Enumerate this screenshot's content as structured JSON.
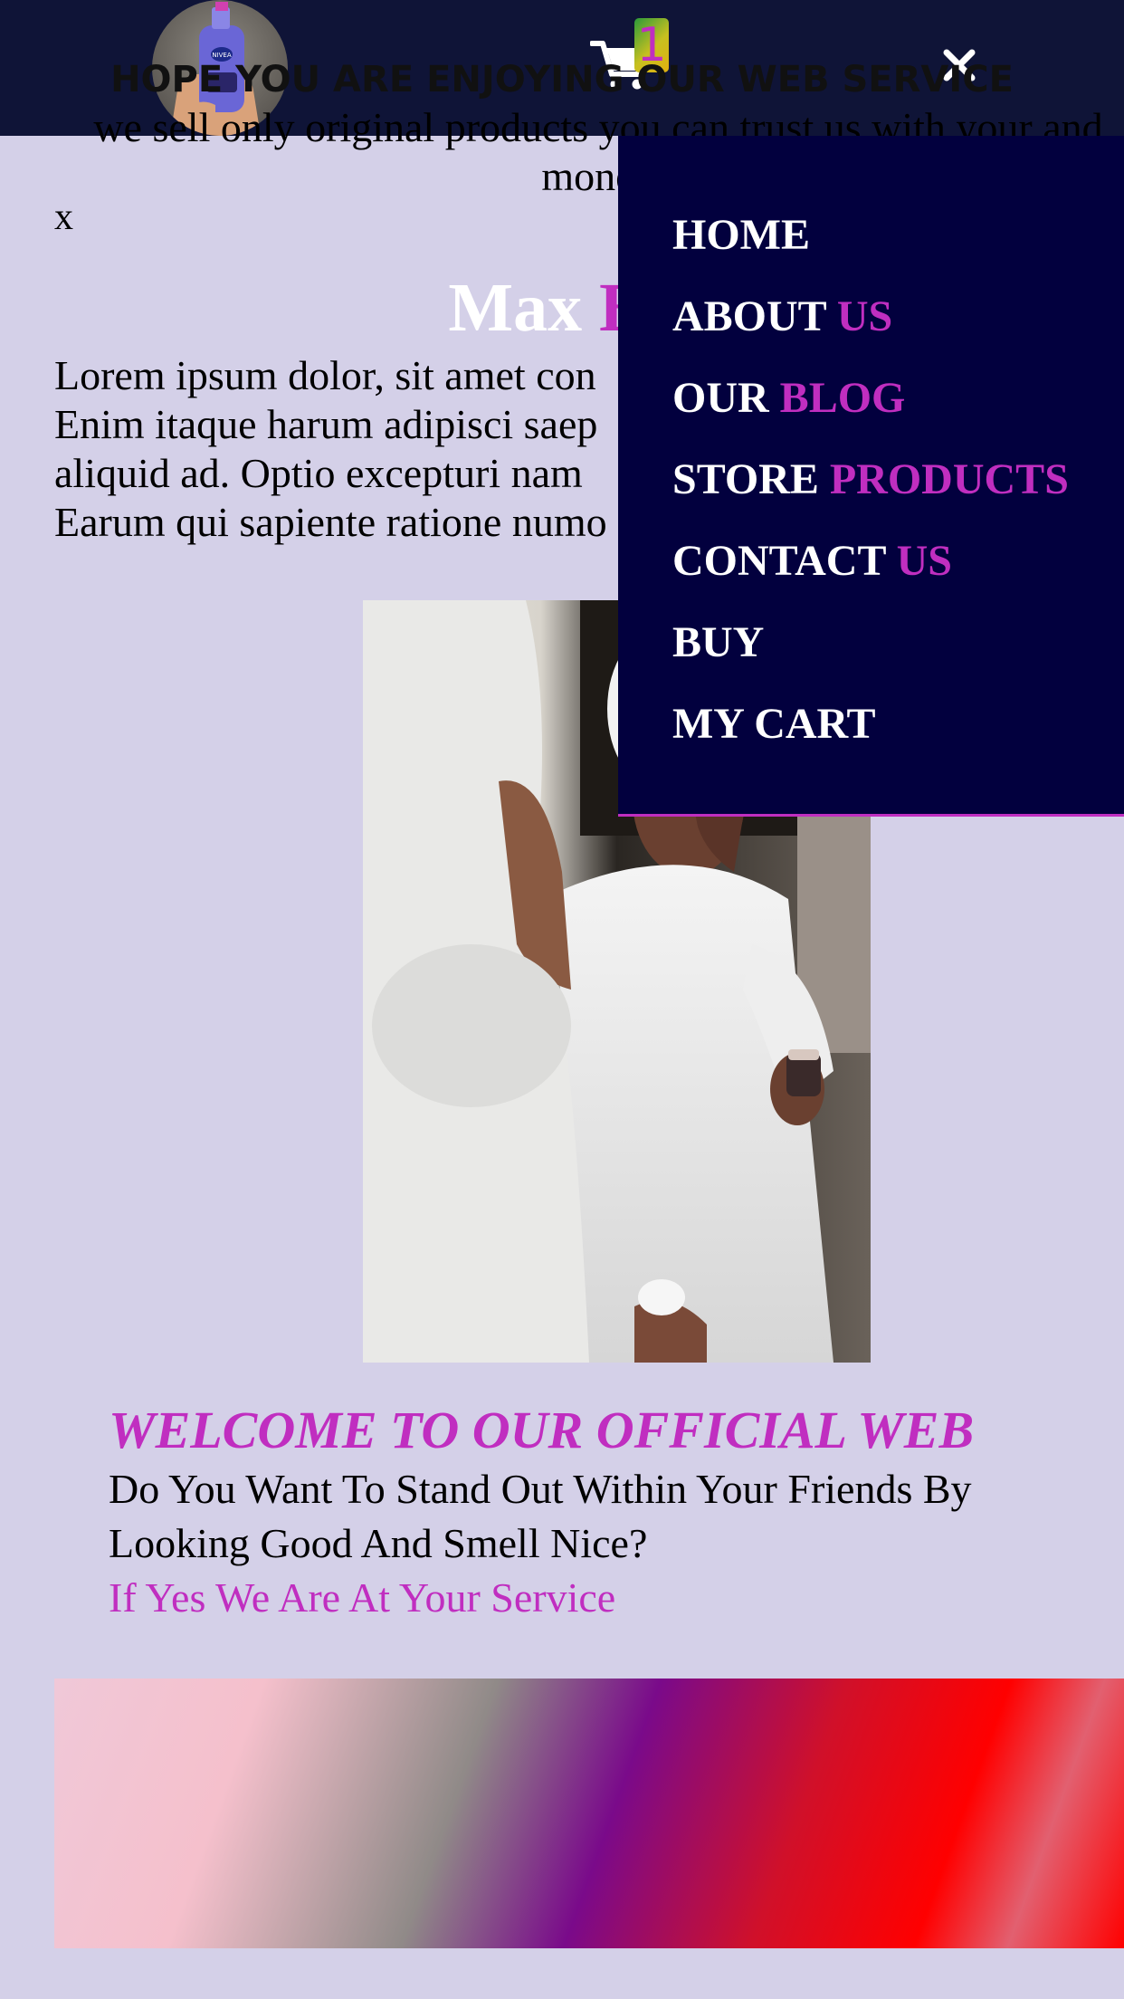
{
  "header": {
    "logo_alt": "NIVEA",
    "cart_count": "1"
  },
  "page": {
    "close_label": "x",
    "hero_title_white": "Max ",
    "hero_title_accent": "Be",
    "lorem": "Lorem ipsum dolor, sit amet con Enim itaque harum adipisci saep aliquid ad. Optio excepturi nam Earum qui sapiente ratione numo",
    "lorem_lines": [
      "Lorem ipsum dolor, sit amet con",
      "Enim itaque harum adipisci saep",
      "aliquid ad. Optio excepturi nam",
      "Earum qui sapiente ratione numo"
    ],
    "welcome": "WELCOME TO OUR OFFICIAL WEB",
    "question_line1": "Do You Want To Stand Out Within Your Friends By",
    "question_line2": "Looking Good And Smell Nice?",
    "service": "If Yes We Are At Your Service"
  },
  "banner": {
    "title": "HOPE YOU ARE ENJOYING OUR WEB SERVICE",
    "text": "we sell only original products you can trust us with your and money"
  },
  "menu": {
    "items": [
      {
        "label": "HOME",
        "accent": ""
      },
      {
        "label": "ABOUT ",
        "accent": "US"
      },
      {
        "label": "OUR ",
        "accent": "BLOG"
      },
      {
        "label": "STORE ",
        "accent": "PRODUCTS"
      },
      {
        "label": "CONTACT ",
        "accent": "US"
      },
      {
        "label": "BUY",
        "accent": ""
      },
      {
        "label": "MY CART",
        "accent": ""
      }
    ]
  },
  "colors": {
    "header_bg": "#0f1437",
    "page_bg": "#d4d0e8",
    "menu_bg": "#02003e",
    "accent": "#c02ec0"
  },
  "icons": {
    "cart": "shopping-cart-icon",
    "close": "close-icon",
    "logo": "nivea-bottle-logo"
  }
}
